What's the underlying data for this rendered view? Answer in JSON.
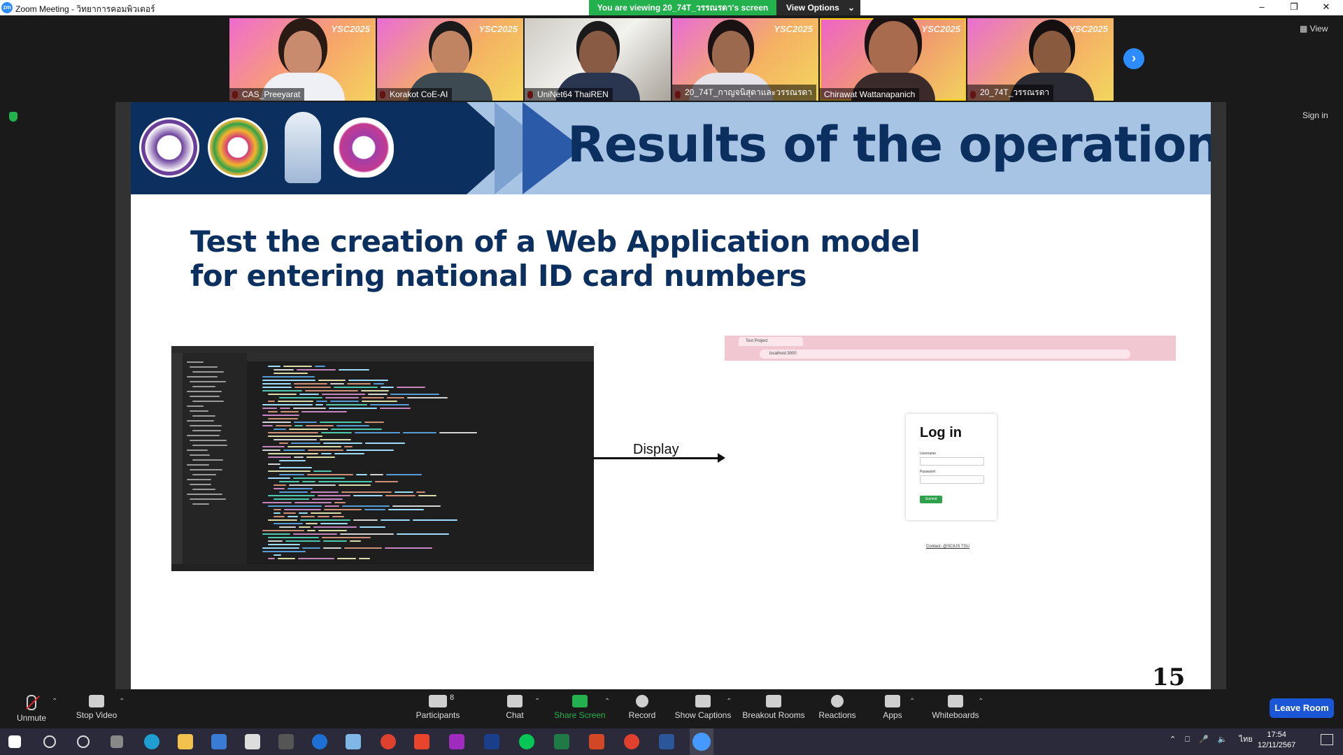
{
  "titlebar": {
    "app_title": "Zoom Meeting - วิทยาการคอมพิวเตอร์",
    "viewing_banner": "You are viewing 20_74T_วรรณรดา's screen",
    "view_options": "View Options"
  },
  "participants": [
    {
      "name": "CAS_Preeyarat"
    },
    {
      "name": "Korakot CoE-AI"
    },
    {
      "name": "UniNet64 ThaiREN"
    },
    {
      "name": "20_74T_กาญจนิสุดาและวรรณรดา"
    },
    {
      "name": "Chirawat Wattanapanich"
    },
    {
      "name": "20_74T_วรรณรดา"
    }
  ],
  "tile_watermark": "YSC2025",
  "view_button": "View",
  "sign_in": "Sign in",
  "slide": {
    "title": "Results of the operation",
    "subtitle_line1": "Test the creation of a Web Application model",
    "subtitle_line2": "for entering national ID card numbers",
    "display_label": "Display",
    "page_number": "15",
    "browser_tab": "Test Project",
    "browser_url": "localhost:3000",
    "login": {
      "heading": "Log in",
      "username_label": "Username",
      "password_label": "Password",
      "submit_label": "Summit"
    },
    "contact": "Contact: @SCIUS TSU"
  },
  "toolbar": {
    "unmute": "Unmute",
    "stop_video": "Stop Video",
    "participants": "Participants",
    "participants_count": "8",
    "chat": "Chat",
    "share_screen": "Share Screen",
    "record": "Record",
    "show_captions": "Show Captions",
    "breakout_rooms": "Breakout Rooms",
    "reactions": "Reactions",
    "apps": "Apps",
    "whiteboards": "Whiteboards",
    "leave_room": "Leave Room"
  },
  "taskbar": {
    "language": "ไทย",
    "time": "17:54",
    "date": "12/11/2567"
  },
  "colors": {
    "accent_green": "#23b14d",
    "zoom_blue": "#2d8cff",
    "leave_blue": "#1a56d6",
    "slide_navy": "#0b3060"
  }
}
